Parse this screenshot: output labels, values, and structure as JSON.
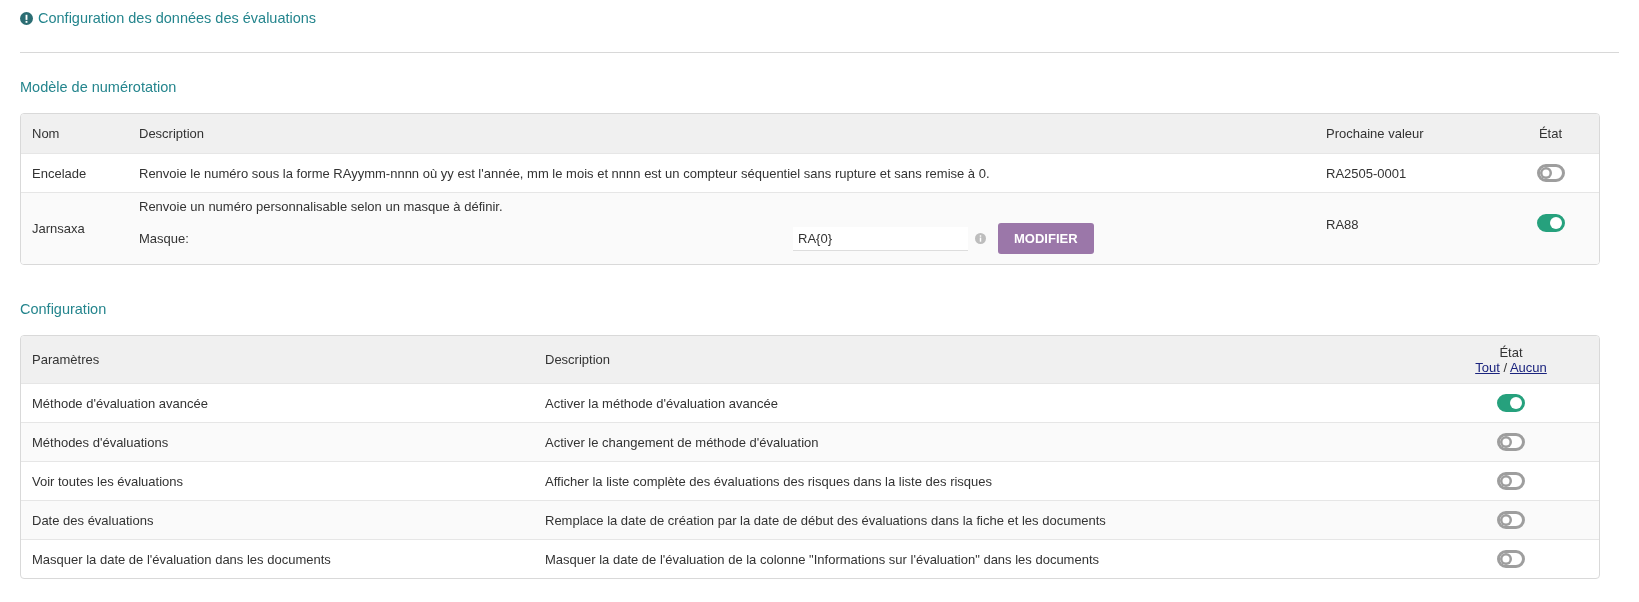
{
  "page_title": "Configuration des données des évaluations",
  "numbering": {
    "title": "Modèle de numérotation",
    "columns": [
      "Nom",
      "Description",
      "Prochaine valeur",
      "État"
    ],
    "rows": [
      {
        "kind": "plain",
        "name": "Encelade",
        "description": "Renvoie le numéro sous la forme RAyymm-nnnn où yy est l'année, mm le mois et nnnn est un compteur séquentiel sans rupture et sans remise à 0.",
        "next_value": "RA2505-0001",
        "on": false
      },
      {
        "kind": "mask",
        "name": "Jarnsaxa",
        "description": "Renvoie un numéro personnalisable selon un masque à définir.",
        "mask_label": "Masque:",
        "mask_value": "RA{0}",
        "button": "MODIFIER",
        "next_value": "RA88",
        "on": true
      }
    ]
  },
  "configuration": {
    "title": "Configuration",
    "columns": [
      "Paramètres",
      "Description",
      "État"
    ],
    "all_link": "Tout",
    "separator": "/",
    "none_link": "Aucun",
    "rows": [
      {
        "name": "Méthode d'évaluation avancée",
        "description": "Activer la méthode d'évaluation avancée",
        "on": true
      },
      {
        "name": "Méthodes d'évaluations",
        "description": "Activer le changement de méthode d'évaluation",
        "on": false
      },
      {
        "name": "Voir toutes les évaluations",
        "description": "Afficher la liste complète des évaluations des risques dans la liste des risques",
        "on": false
      },
      {
        "name": "Date des évaluations",
        "description": "Remplace la date de création par la date de début des évaluations dans la fiche et les documents",
        "on": false
      },
      {
        "name": "Masquer la date de l'évaluation dans les documents",
        "description": "Masquer la date de l'évaluation de la colonne \"Informations sur l'évaluation\" dans les documents",
        "on": false
      }
    ]
  }
}
